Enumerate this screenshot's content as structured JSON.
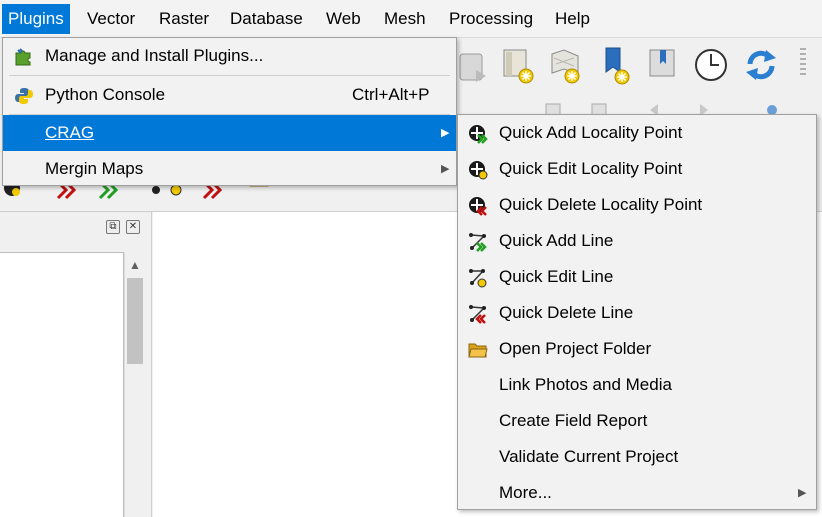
{
  "menubar": {
    "items": [
      "Plugins",
      "Vector",
      "Raster",
      "Database",
      "Web",
      "Mesh",
      "Processing",
      "Help"
    ]
  },
  "plugins_menu": {
    "items": [
      {
        "label": "Manage and Install Plugins...",
        "icon": "puzzle-icon"
      },
      {
        "label": "Python Console",
        "shortcut": "Ctrl+Alt+P",
        "icon": "python-icon"
      },
      {
        "label": "CRAG",
        "submenu": true
      },
      {
        "label": "Mergin Maps",
        "submenu": true
      }
    ]
  },
  "crag_menu": {
    "items": [
      {
        "label": "Quick Add Locality Point",
        "icon": "add-point-icon"
      },
      {
        "label": "Quick Edit Locality Point",
        "icon": "edit-point-icon"
      },
      {
        "label": "Quick Delete Locality Point",
        "icon": "delete-point-icon"
      },
      {
        "label": "Quick Add Line",
        "icon": "add-line-icon"
      },
      {
        "label": "Quick Edit Line",
        "icon": "edit-line-icon"
      },
      {
        "label": "Quick Delete Line",
        "icon": "delete-line-icon"
      },
      {
        "label": "Open Project Folder",
        "icon": "folder-icon"
      },
      {
        "label": "Link Photos and Media"
      },
      {
        "label": "Create Field Report"
      },
      {
        "label": "Validate Current Project"
      },
      {
        "label": "More...",
        "submenu": true
      }
    ]
  },
  "colors": {
    "highlight": "#0078d7",
    "menu_bg": "#f2f2f2"
  }
}
